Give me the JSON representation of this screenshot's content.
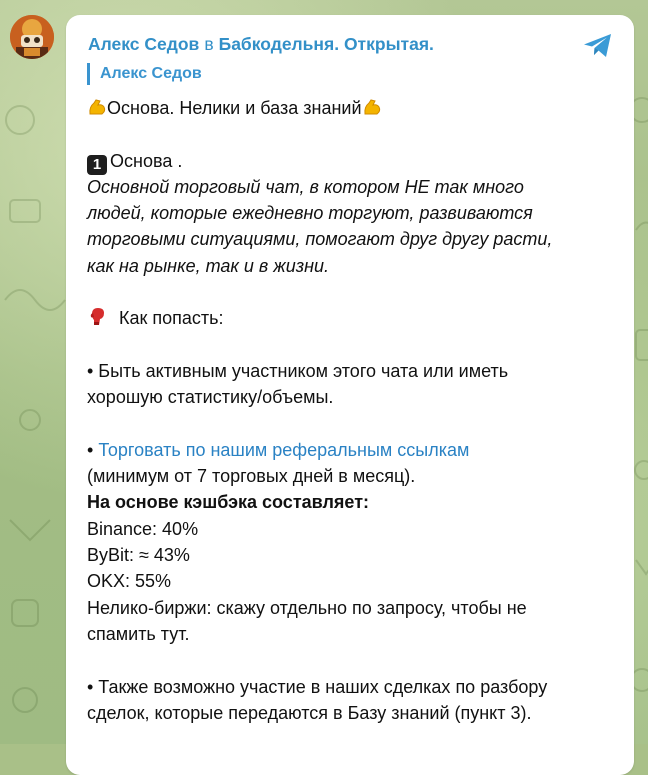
{
  "post": {
    "author": "Алекс Седов",
    "in_word": "в",
    "channel": "Бабкодельня. Открытая.",
    "forwarded_from": "Алекс Седов"
  },
  "message": {
    "title": "Основа. Нелики и база знаний",
    "section1_heading": "Основа .",
    "section1_badge": "1",
    "section1_desc": [
      "Основной торговый чат, в котором НЕ так много",
      "людей, которые ежедневно торгуют, развиваются",
      "торговыми ситуациями, помогают друг другу расти,",
      "как на рынке, так и в жизни."
    ],
    "how_to_join": "Как попасть:",
    "bullet1": [
      "• Быть активным участником этого чата или иметь",
      "хорошую статистику/объемы."
    ],
    "bullet2_prefix": "• ",
    "bullet2_link": "Торговать по нашим реферальным ссылкам",
    "bullet2_rest": "(минимум от 7 торговых дней в месяц).",
    "cashback_heading": "На основе кэшбэка составляет:",
    "cashback": [
      "Binance: 40%",
      "ByBit: ≈ 43%",
      "OKX: 55%",
      "Нелико-биржи: скажу отдельно по запросу, чтобы не",
      "спамить тут."
    ],
    "bullet3": [
      "• Также возможно участие в наших сделках по разбору",
      "сделок, которые передаются в Базу знаний (пункт 3)."
    ]
  },
  "icons": {
    "share": "share-telegram-icon",
    "flexed_biceps": "flexed-biceps-icon",
    "boxing_glove": "boxing-glove-icon",
    "keycap_one": "keycap-1-icon",
    "avatar": "avatar"
  },
  "colors": {
    "accent": "#3390c8",
    "link": "#2a82c4",
    "bubble": "#ffffff",
    "wallpaper": "#a9c088"
  }
}
